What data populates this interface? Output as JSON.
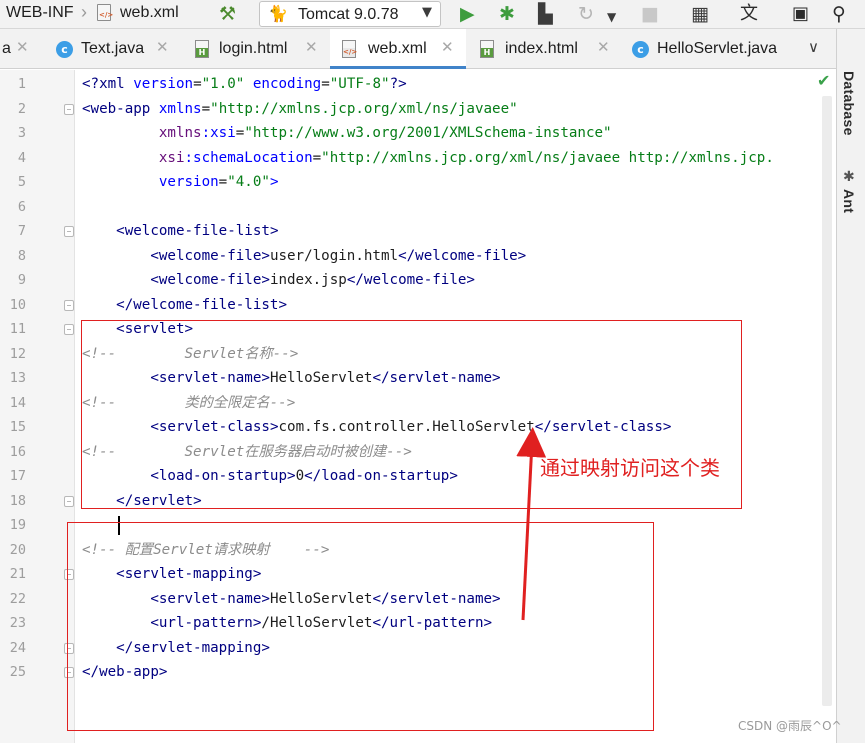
{
  "breadcrumb": {
    "folder": "WEB-INF",
    "file": "web.xml"
  },
  "toolbar": {
    "run_config": "Tomcat 9.0.78",
    "icons": [
      "build-hammer-icon",
      "tomcat-icon",
      "run-icon",
      "debug-icon",
      "coverage-icon",
      "profile-icon",
      "stop-icon",
      "project-structure-icon",
      "translate-icon",
      "terminal-icon",
      "search-icon"
    ]
  },
  "tabs": [
    {
      "label": "a",
      "icon": "java-class-icon"
    },
    {
      "label": "Text.java",
      "icon": "java-class-icon"
    },
    {
      "label": "login.html",
      "icon": "html-file-icon"
    },
    {
      "label": "web.xml",
      "icon": "xml-file-icon",
      "active": true
    },
    {
      "label": "index.html",
      "icon": "html-file-icon"
    },
    {
      "label": "HelloServlet.java",
      "icon": "java-class-icon"
    }
  ],
  "side_panel": {
    "database": "Database",
    "ant": "Ant"
  },
  "editor": {
    "line_numbers": [
      "1",
      "2",
      "3",
      "4",
      "5",
      "6",
      "7",
      "8",
      "9",
      "10",
      "11",
      "12",
      "13",
      "14",
      "15",
      "16",
      "17",
      "18",
      "19",
      "20",
      "21",
      "22",
      "23",
      "24",
      "25"
    ],
    "current_line": 19,
    "lines": [
      "<?xml version=\"1.0\" encoding=\"UTF-8\"?>",
      "<web-app xmlns=\"http://xmlns.jcp.org/xml/ns/javaee\"",
      "         xmlns:xsi=\"http://www.w3.org/2001/XMLSchema-instance\"",
      "         xsi:schemaLocation=\"http://xmlns.jcp.org/xml/ns/javaee http://xmlns.jcp.",
      "         version=\"4.0\">",
      "",
      "    <welcome-file-list>",
      "        <welcome-file>user/login.html</welcome-file>",
      "        <welcome-file>index.jsp</welcome-file>",
      "    </welcome-file-list>",
      "    <servlet>",
      "<!--        Servlet名称-->",
      "        <servlet-name>HelloServlet</servlet-name>",
      "<!--        类的全限定名-->",
      "        <servlet-class>com.fs.controller.HelloServlet</servlet-class>",
      "<!--        Servlet在服务器启动时被创建-->",
      "        <load-on-startup>0</load-on-startup>",
      "    </servlet>",
      "",
      "<!-- 配置Servlet请求映射    -->",
      "    <servlet-mapping>",
      "        <servlet-name>HelloServlet</servlet-name>",
      "        <url-pattern>/HelloServlet</url-pattern>",
      "    </servlet-mapping>",
      "</web-app>"
    ]
  },
  "annotation": {
    "text": "通过映射访问这个类",
    "color": "#e02020"
  },
  "watermark": "CSDN @雨辰^O^",
  "colors": {
    "tag": "#000080",
    "attribute": "#0000ff",
    "namespace": "#660e7a",
    "string": "#067d17",
    "comment": "#8c8c8c",
    "annotation_red": "#e02020",
    "active_tab_underline": "#4083c9"
  }
}
